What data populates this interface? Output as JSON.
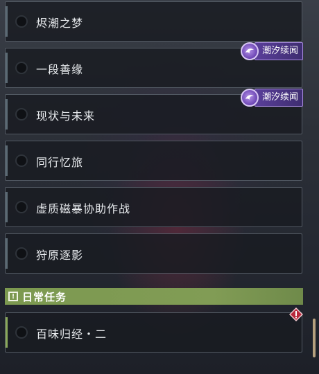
{
  "quests": [
    {
      "title": "烬潮之梦",
      "tag": ""
    },
    {
      "title": "一段善缘",
      "tag": "潮汐续闻"
    },
    {
      "title": "现状与未来",
      "tag": "潮汐续闻"
    },
    {
      "title": "同行忆旅",
      "tag": ""
    },
    {
      "title": "虚质磁暴协助作战",
      "tag": ""
    },
    {
      "title": "狩原逐影",
      "tag": ""
    }
  ],
  "daily_section": {
    "label": "日常任务",
    "icon": "exclamation-box-icon",
    "color": "#809b55"
  },
  "daily_quests": [
    {
      "title": "百味归经・二"
    }
  ],
  "colors": {
    "tag_purple": "#5a3f9a",
    "warning_red": "#b8283c"
  }
}
